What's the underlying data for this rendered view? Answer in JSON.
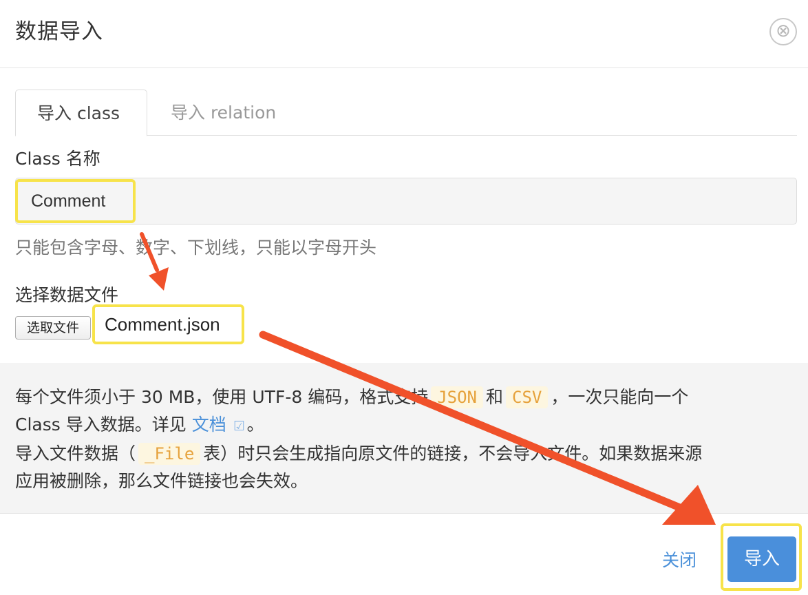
{
  "dialog": {
    "title": "数据导入",
    "close_icon": "⊗"
  },
  "tabs": [
    {
      "label": "导入 class",
      "active": true
    },
    {
      "label": "导入 relation",
      "active": false
    }
  ],
  "form": {
    "class_label": "Class 名称",
    "class_value": "Comment",
    "class_hint": "只能包含字母、数字、下划线，只能以字母开头",
    "file_label": "选择数据文件",
    "file_button": "选取文件",
    "file_name": "Comment.json"
  },
  "info": {
    "line1_a": "每个文件须小于 30 MB，使用 UTF-8 编码，格式支持",
    "code_json": "JSON",
    "line1_b": "和",
    "code_csv": "CSV",
    "line1_c": "，一次只能向一个",
    "line2_a": "Class 导入数据。详见",
    "doc_link": "文档",
    "external_icon": "☑",
    "line2_b": "。",
    "line3_a": "导入文件数据（",
    "code_file": "_File",
    "line3_b": "表）时只会生成指向原文件的链接，不会导入文件。如果数据来源",
    "line4": "应用被删除，那么文件链接也会失效。"
  },
  "footer": {
    "close_label": "关闭",
    "import_label": "导入"
  },
  "colors": {
    "accent": "#4a8fdb",
    "highlight": "#f7e34a",
    "arrow": "#f0512a",
    "code_text": "#e6a23c"
  }
}
